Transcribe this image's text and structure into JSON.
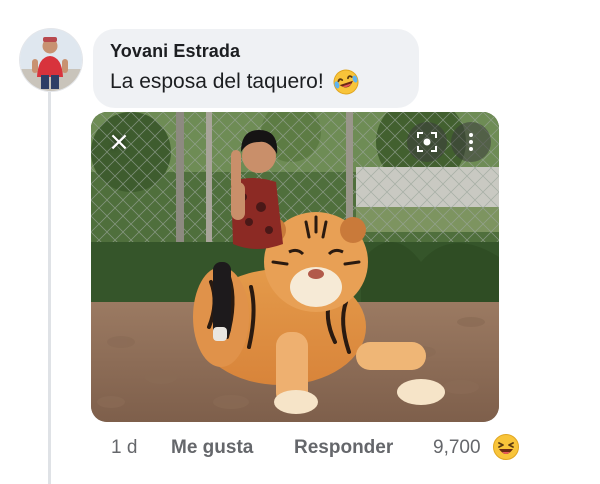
{
  "comment": {
    "author": "Yovani Estrada",
    "text": "La esposa del taquero!",
    "text_emoji": "laughing-tears-emoji",
    "photo_icons": {
      "close": "×",
      "lens": "lens-scan-icon",
      "more": "more-vertical-icon"
    }
  },
  "actions": {
    "time": "1 d",
    "like_label": "Me gusta",
    "reply_label": "Responder",
    "reaction_count": "9,700",
    "reaction_emoji": "laughing-face-emoji"
  },
  "colors": {
    "bubble": "#eff1f4",
    "text": "#1c1e21",
    "secondary": "#65676b",
    "emoji_yellow": "#f8c43a"
  }
}
